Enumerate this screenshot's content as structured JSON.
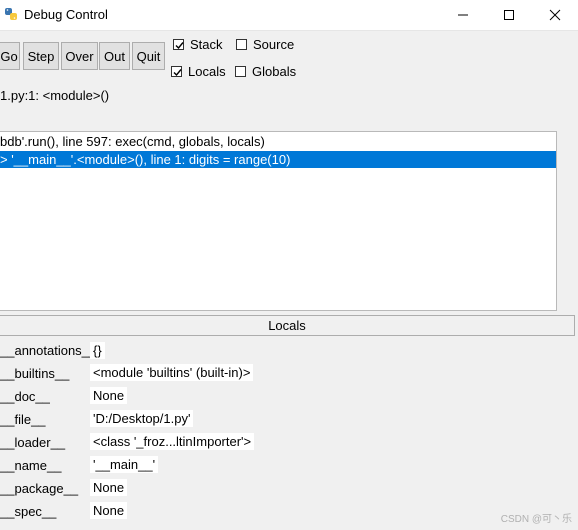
{
  "window": {
    "title": "Debug Control",
    "icon": "python-icon",
    "controls": [
      "minimize-icon",
      "maximize-icon",
      "close-icon"
    ]
  },
  "toolbar": {
    "buttons": [
      "Go",
      "Step",
      "Over",
      "Out",
      "Quit"
    ],
    "checkboxes": [
      {
        "label": "Stack",
        "checked": true
      },
      {
        "label": "Source",
        "checked": false
      },
      {
        "label": "Locals",
        "checked": true
      },
      {
        "label": "Globals",
        "checked": false
      }
    ]
  },
  "status": "1.py:1: <module>()",
  "stack": {
    "rows": [
      {
        "text": "bdb'.run(), line 597: exec(cmd, globals, locals)",
        "selected": false
      },
      {
        "text": "> '__main__'.<module>(), line 1: digits = range(10)",
        "selected": true
      }
    ],
    "selection_color": "#0078d7"
  },
  "locals": {
    "header": "Locals",
    "items": [
      {
        "name": "__annotations__",
        "value": "{}"
      },
      {
        "name": "__builtins__",
        "value": "<module 'builtins' (built-in)>"
      },
      {
        "name": "__doc__",
        "value": "None"
      },
      {
        "name": "__file__",
        "value": "'D:/Desktop/1.py'"
      },
      {
        "name": "__loader__",
        "value": "<class '_froz...ltinImporter'>"
      },
      {
        "name": "__name__",
        "value": "'__main__'"
      },
      {
        "name": "__package__",
        "value": "None"
      },
      {
        "name": "__spec__",
        "value": "None"
      }
    ]
  },
  "watermark": "CSDN @可丶乐"
}
